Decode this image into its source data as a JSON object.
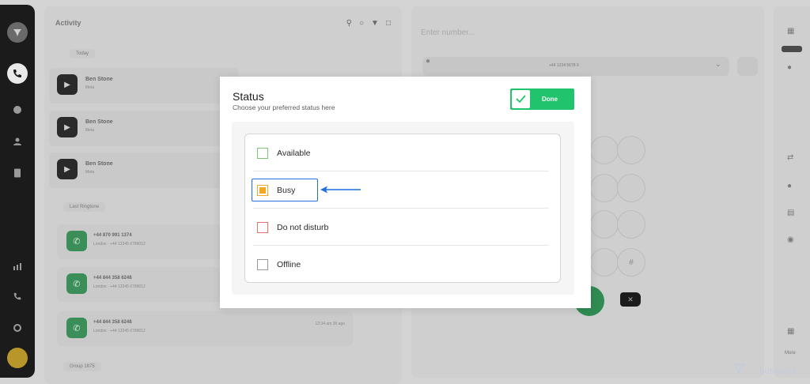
{
  "background": {
    "activity": {
      "title": "Activity",
      "section_today": "Today",
      "section_last": "Last Ringtone",
      "section_groups": "Group 1875",
      "groups": [
        {
          "name": "Ben Stone",
          "sub": "Meta"
        },
        {
          "name": "Ben Stone",
          "sub": "Meta"
        },
        {
          "name": "Ben Stone",
          "sub": "Meta"
        }
      ],
      "calls": [
        {
          "number": "+44 870 991 1374",
          "sub": "London · +44 12345 6789012",
          "time": ""
        },
        {
          "number": "+44 844 358 6248",
          "sub": "London · +44 12345 6789012",
          "time": ""
        },
        {
          "number": "+44 844 358 6248",
          "sub": "London · +44 12345 6789012",
          "time": "12:34 am\n3h ago"
        }
      ]
    },
    "dialer": {
      "placeholder": "Enter number...",
      "select_label": "+44 1234 5678 9"
    },
    "right_rail": {
      "label": "More"
    },
    "watermark": "business"
  },
  "modal": {
    "title": "Status",
    "subtitle": "Choose your preferred status here",
    "done_label": "Done",
    "options": [
      {
        "label": "Available",
        "color": "#7cc576",
        "filled": false
      },
      {
        "label": "Busy",
        "color": "#f5a623",
        "filled": true
      },
      {
        "label": "Do not disturb",
        "color": "#e8716a",
        "filled": false
      },
      {
        "label": "Offline",
        "color": "#9a9a9a",
        "filled": false
      }
    ],
    "highlight_color": "#1f6fe0",
    "accent_color": "#21c46c"
  }
}
